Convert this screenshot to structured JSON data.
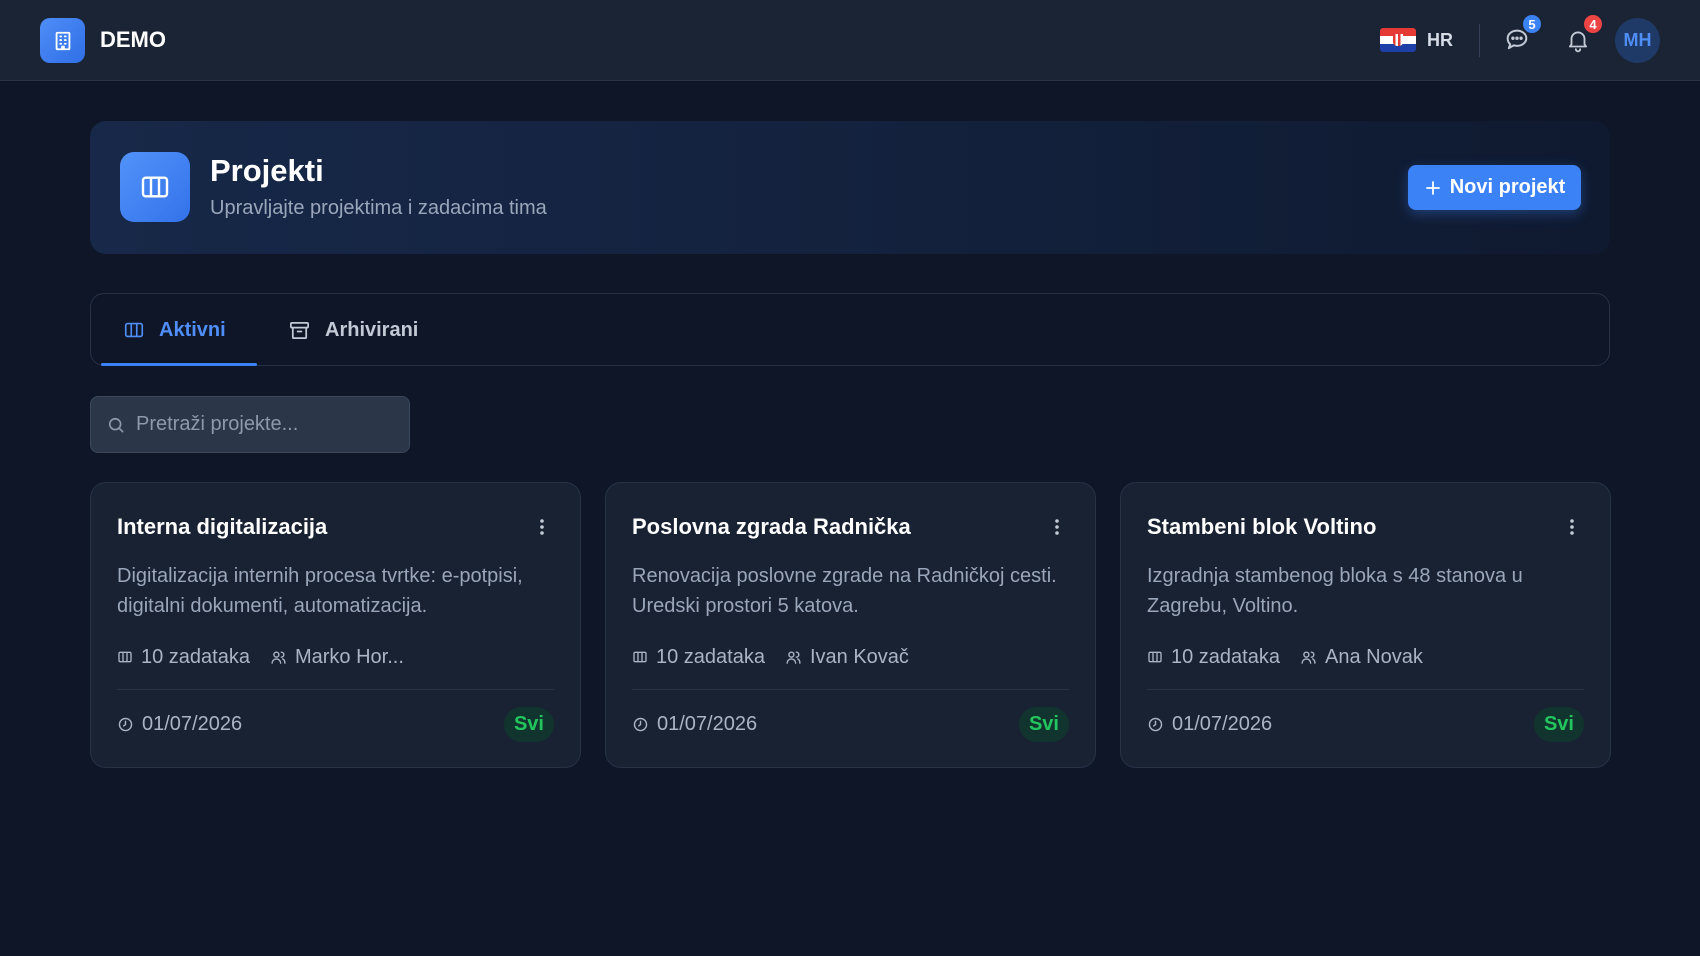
{
  "topbar": {
    "brand": "DEMO",
    "language_code": "HR",
    "messages_count": "5",
    "notifications_count": "4",
    "user_initials": "MH"
  },
  "header": {
    "title": "Projekti",
    "subtitle": "Upravljajte projektima i zadacima tima",
    "new_button_label": "Novi projekt"
  },
  "tabs": [
    {
      "label": "Aktivni",
      "active": true
    },
    {
      "label": "Arhivirani",
      "active": false
    }
  ],
  "search": {
    "placeholder": "Pretraži projekte..."
  },
  "projects": [
    {
      "title": "Interna digitalizacija",
      "description": "Digitalizacija internih procesa tvrtke: e-potpisi, digitalni dokumenti, automatizacija.",
      "tasks": "10 zadataka",
      "owner": "Marko Hor...",
      "date": "01/07/2026",
      "badge": "Svi"
    },
    {
      "title": "Poslovna zgrada Radnička",
      "description": "Renovacija poslovne zgrade na Radničkoj cesti. Uredski prostori 5 katova.",
      "tasks": "10 zadataka",
      "owner": "Ivan Kovač",
      "date": "01/07/2026",
      "badge": "Svi"
    },
    {
      "title": "Stambeni blok Voltino",
      "description": "Izgradnja stambenog bloka s 48 stanova u Zagrebu, Voltino.",
      "tasks": "10 zadataka",
      "owner": "Ana Novak",
      "date": "01/07/2026",
      "badge": "Svi"
    }
  ],
  "colors": {
    "accent": "#3b82f6",
    "background": "#0e1628",
    "topbar": "#1b2434",
    "card": "#182233",
    "badge_green": "#22c55e",
    "notification_red": "#ef4444"
  },
  "icons": {
    "brand": "building-icon",
    "header": "columns-icon",
    "messages": "chat-bubble-icon",
    "notifications": "bell-icon",
    "tab_active": "columns-icon",
    "tab_archived": "archive-box-icon",
    "search": "search-icon",
    "card_menu": "kebab-menu-icon",
    "tasks": "columns-icon",
    "owner": "users-icon",
    "date": "clock-icon"
  }
}
